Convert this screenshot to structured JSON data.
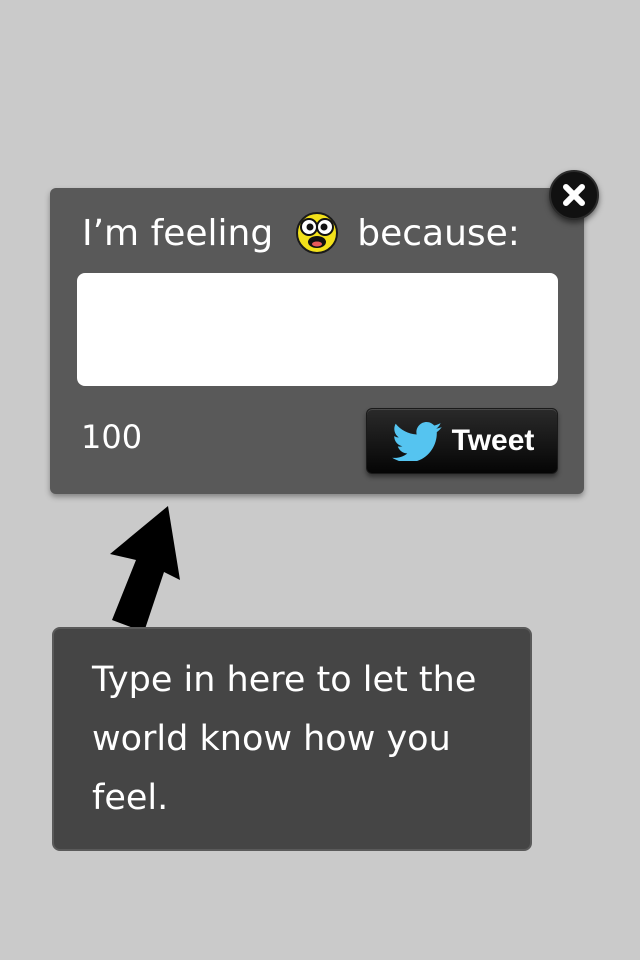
{
  "composer": {
    "prompt_before": "I’m feeling",
    "mood_icon": "surprised-face-icon",
    "prompt_after": "because:",
    "input_value": "",
    "char_count": "100",
    "tweet_label": "Tweet",
    "tweet_icon": "twitter-bird-icon",
    "close_icon": "close-icon"
  },
  "tooltip": {
    "text": "Type in here to let the world know how you feel."
  },
  "colors": {
    "background": "#cacaca",
    "card": "#595959",
    "tooltip": "#454545",
    "twitter_blue": "#55c4f0",
    "emoji_yellow": "#f2e11a"
  }
}
